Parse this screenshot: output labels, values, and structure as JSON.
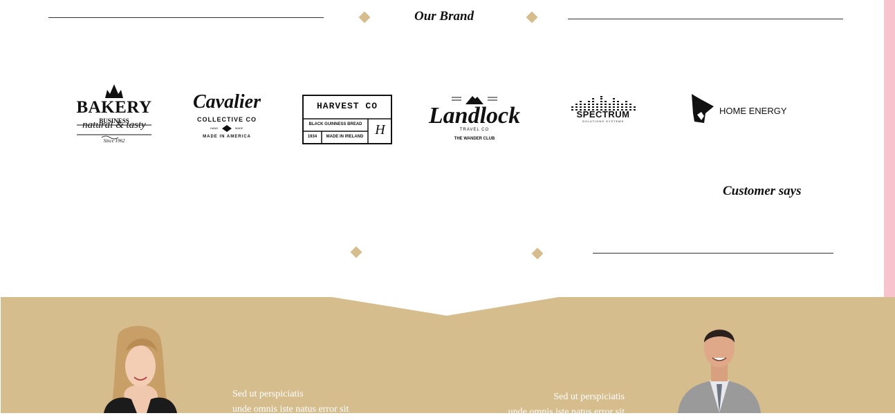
{
  "brand_section": {
    "title": "Our Brand",
    "logos": [
      {
        "icon": "bakery-logo",
        "lines": [
          "BAKERY",
          "BUSINESS",
          "natural & tasty",
          "Since 1962"
        ]
      },
      {
        "icon": "cavalier-logo",
        "lines": [
          "Cavalier",
          "COLLECTIVE CO",
          "HAND",
          "MADE",
          "MADE IN AMERICA"
        ]
      },
      {
        "icon": "harvest-co-logo",
        "lines": [
          "HARVEST CO",
          "BLACK GUINNESS BREAD",
          "1934",
          "MADE IN IRELAND",
          "H"
        ]
      },
      {
        "icon": "landlock-logo",
        "lines": [
          "Landlock",
          "TRAVEL CO",
          "THE WANDER CLUB"
        ]
      },
      {
        "icon": "spectrum-logo",
        "lines": [
          "SPECTRUM",
          "SOLUTIONS SYSTEMS"
        ]
      },
      {
        "icon": "home-energy-logo",
        "lines": [
          "HOME ENERGY"
        ]
      }
    ]
  },
  "customer_section": {
    "title": "Customer says",
    "testimonials": [
      {
        "avatar": "woman-photo",
        "lines": [
          "Sed ut perspiciatis",
          "unde omnis iste natus error sit"
        ]
      },
      {
        "avatar": "man-photo",
        "lines": [
          "Sed ut perspiciatis",
          "unde omnis iste natus error sit"
        ]
      }
    ]
  },
  "colors": {
    "accent": "#d6bd8e",
    "side_bar": "#f8c3cc",
    "line": "#333333",
    "text_on_accent": "#ffffff"
  }
}
